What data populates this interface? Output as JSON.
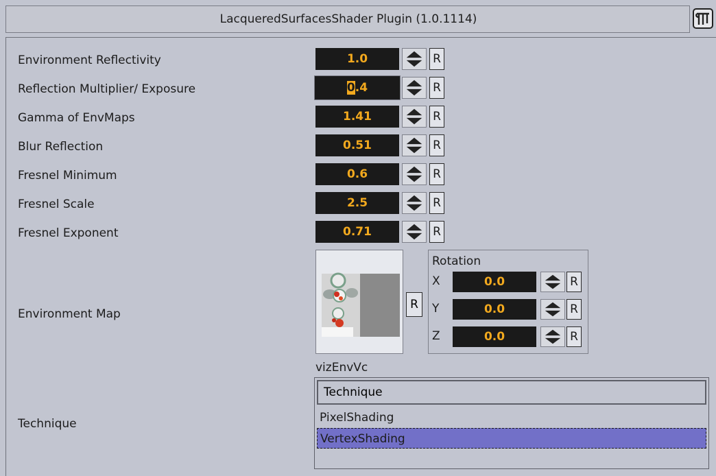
{
  "window": {
    "title": "LacqueredSurfacesShader Plugin (1.0.1114)",
    "icon": "plugin-icon"
  },
  "params": [
    {
      "label": "Environment Reflectivity",
      "value": "1.0",
      "reset": "R"
    },
    {
      "label": "Reflection Multiplier/ Exposure",
      "value_hl": "0",
      "value_rest": ".4",
      "reset": "R",
      "editing": true
    },
    {
      "label": "Gamma of EnvMaps",
      "value": "1.41",
      "reset": "R"
    },
    {
      "label": "Blur Reflection",
      "value": "0.51",
      "reset": "R"
    },
    {
      "label": "Fresnel Minimum",
      "value": "0.6",
      "reset": "R"
    },
    {
      "label": "Fresnel Scale",
      "value": "2.5",
      "reset": "R"
    },
    {
      "label": "Fresnel Exponent",
      "value": "0.71",
      "reset": "R"
    }
  ],
  "env_map": {
    "label": "Environment Map",
    "name": "vizEnvVc",
    "reset": "R",
    "rotation": {
      "title": "Rotation",
      "axes": [
        {
          "axis": "X",
          "value": "0.0",
          "reset": "R"
        },
        {
          "axis": "Y",
          "value": "0.0",
          "reset": "R"
        },
        {
          "axis": "Z",
          "value": "0.0",
          "reset": "R"
        }
      ]
    }
  },
  "technique": {
    "label": "Technique",
    "header": "Technique",
    "options": [
      "PixelShading",
      "VertexShading"
    ],
    "selected": "VertexShading"
  },
  "colors": {
    "field_bg": "#1a1a1a",
    "field_text": "#f2a91e",
    "panel_bg": "#c2c5d0",
    "selection": "#7270c8"
  }
}
